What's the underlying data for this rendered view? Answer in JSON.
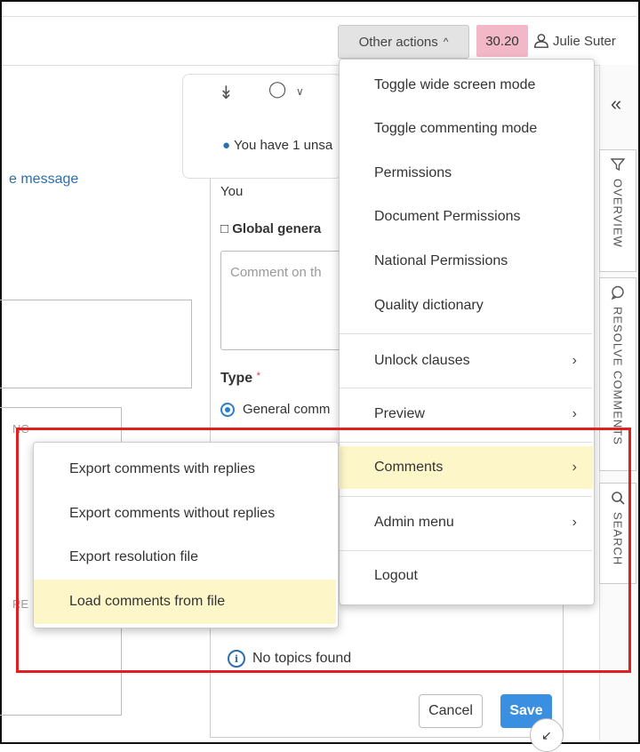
{
  "header": {
    "other_actions_label": "Other actions",
    "version_badge": "30.20",
    "user_name": "Julie Suter"
  },
  "background": {
    "message_link": "e message",
    "left_fragment_1": "NC",
    "left_fragment_2": "RE"
  },
  "comment_panel": {
    "unsaved_notice": "You have 1 unsa",
    "author": "You",
    "global_general_label": "Global genera",
    "comment_placeholder": "Comment on th",
    "type_label": "Type",
    "required_mark": "*",
    "radio_general": "General comm",
    "no_topics": "No topics found",
    "cancel_label": "Cancel",
    "save_label": "Save"
  },
  "sidebar": {
    "tabs": [
      {
        "label": "OVERVIEW"
      },
      {
        "label": "RESOLVE COMMENTS"
      },
      {
        "label": "SEARCH"
      }
    ]
  },
  "menu": {
    "items": [
      {
        "label": "Toggle wide screen mode"
      },
      {
        "label": "Toggle commenting mode"
      },
      {
        "label": "Permissions"
      },
      {
        "label": "Document Permissions"
      },
      {
        "label": "National Permissions"
      },
      {
        "label": "Quality dictionary"
      },
      {
        "label": "Unlock clauses"
      },
      {
        "label": "Preview"
      },
      {
        "label": "Comments"
      },
      {
        "label": "Admin menu"
      },
      {
        "label": "Logout"
      }
    ]
  },
  "submenu": {
    "items": [
      {
        "label": "Export comments with replies"
      },
      {
        "label": "Export comments without replies"
      },
      {
        "label": "Export resolution file"
      },
      {
        "label": "Load comments from file"
      }
    ]
  },
  "colors": {
    "highlight_border": "#e02020",
    "menu_hover": "#fdf6c9",
    "version_badge_bg": "#f3b8c8",
    "save_button": "#3b8fe0"
  }
}
